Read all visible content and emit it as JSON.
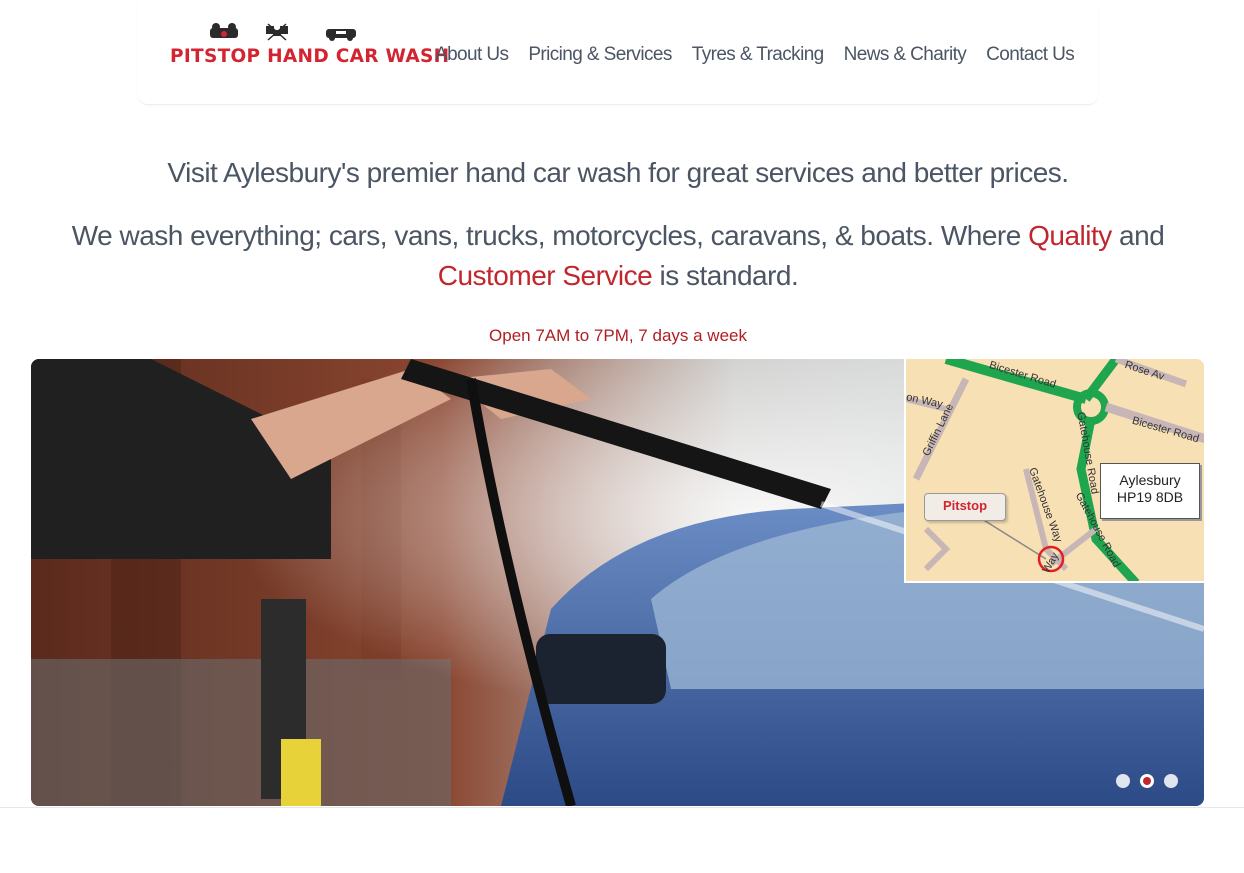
{
  "header": {
    "logo_text": "PITSTOP HAND CAR WASH",
    "nav": [
      "About Us",
      "Pricing & Services",
      "Tyres & Tracking",
      "News & Charity",
      "Contact Us"
    ]
  },
  "intro": {
    "tagline": "Visit Aylesbury's premier hand car wash for great services and better prices.",
    "desc_part1": "We wash everything; cars, vans, trucks, motorcycles, caravans, & boats. Where ",
    "desc_highlight1": "Quality",
    "desc_part2": " and ",
    "desc_highlight2": "Customer Service",
    "desc_part3": " is standard.",
    "hours": "Open 7AM to 7PM, 7 days a week"
  },
  "map": {
    "town": "Aylesbury",
    "postcode": "HP19 8DB",
    "pin_label": "Pitstop",
    "roads": [
      "Bicester Road",
      "Rose Av",
      "Bicester Road",
      "on Way",
      "Griffin Lane",
      "Gatehouse Road",
      "Gatehouse Way",
      "Gatehouse Road",
      "Way"
    ]
  },
  "carousel": {
    "slides": 3,
    "active_index": 1
  },
  "colors": {
    "accent_red": "#c0272d",
    "text_gray": "#4b5563"
  }
}
